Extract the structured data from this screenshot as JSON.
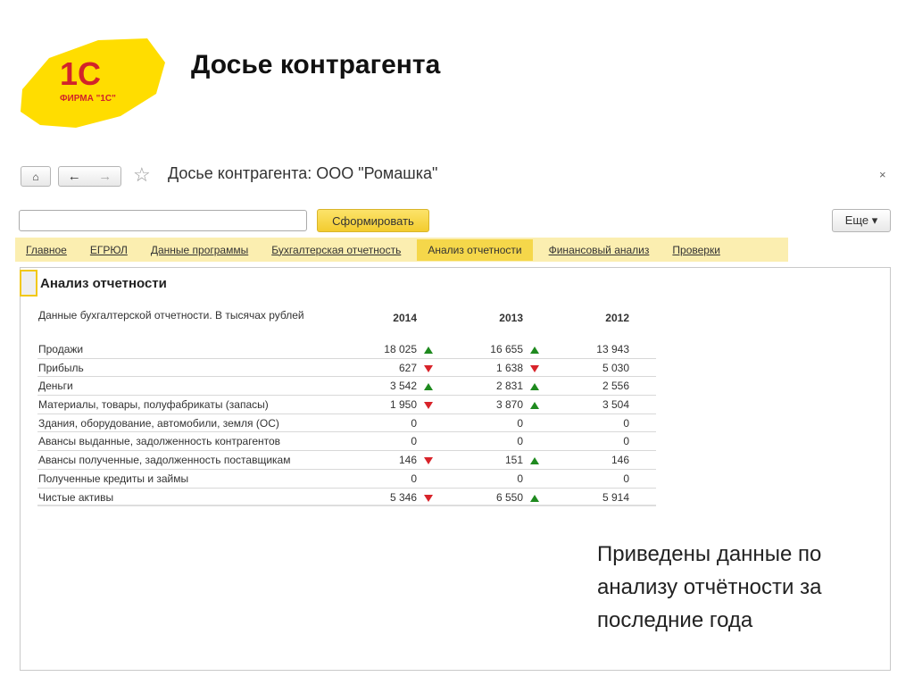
{
  "slide": {
    "title": "Досье контрагента",
    "logo_text": "ФИРМА \"1С\"",
    "logo_mark": "1С",
    "note": "Приведены данные по анализу отчётности за последние года"
  },
  "window": {
    "title": "Досье контрагента: ООО \"Ромашка\"",
    "close": "×"
  },
  "toolbar": {
    "search_value": "",
    "generate_label": "Сформировать",
    "more_label": "Еще ▾"
  },
  "tabs": [
    {
      "label": "Главное"
    },
    {
      "label": "ЕГРЮЛ"
    },
    {
      "label": "Данные программы"
    },
    {
      "label": "Бухгалтерская отчетность"
    },
    {
      "label": "Анализ отчетности",
      "active": true
    },
    {
      "label": "Финансовый анализ"
    },
    {
      "label": "Проверки"
    }
  ],
  "section": {
    "title": "Анализ отчетности"
  },
  "table": {
    "caption": "Данные бухгалтерской отчетности. В тысячах рублей",
    "years": [
      "2014",
      "2013",
      "2012"
    ],
    "rows": [
      {
        "label": "Продажи",
        "values": [
          "18 025",
          "16 655",
          "13 943"
        ],
        "trend": [
          "up",
          "up",
          ""
        ]
      },
      {
        "label": "Прибыль",
        "values": [
          "627",
          "1 638",
          "5 030"
        ],
        "trend": [
          "down",
          "down",
          ""
        ]
      },
      {
        "label": "Деньги",
        "values": [
          "3 542",
          "2 831",
          "2 556"
        ],
        "trend": [
          "up",
          "up",
          ""
        ]
      },
      {
        "label": "Материалы, товары, полуфабрикаты (запасы)",
        "values": [
          "1 950",
          "3 870",
          "3 504"
        ],
        "trend": [
          "down",
          "up",
          ""
        ]
      },
      {
        "label": "Здания, оборудование, автомобили, земля (ОС)",
        "values": [
          "0",
          "0",
          "0"
        ],
        "trend": [
          "",
          "",
          ""
        ]
      },
      {
        "label": "Авансы выданные, задолженность контрагентов",
        "values": [
          "0",
          "0",
          "0"
        ],
        "trend": [
          "",
          "",
          ""
        ]
      },
      {
        "label": "Авансы полученные, задолженность поставщикам",
        "values": [
          "146",
          "151",
          "146"
        ],
        "trend": [
          "down",
          "up",
          ""
        ]
      },
      {
        "label": "Полученные кредиты и займы",
        "values": [
          "0",
          "0",
          "0"
        ],
        "trend": [
          "",
          "",
          ""
        ]
      },
      {
        "label": "Чистые активы",
        "values": [
          "5 346",
          "6 550",
          "5 914"
        ],
        "trend": [
          "down",
          "up",
          ""
        ]
      }
    ]
  },
  "colors": {
    "accent": "#f3cc2f",
    "tabs_bg": "#fbeeb0",
    "up": "#1f8a1f",
    "down": "#d8232a",
    "logo_red": "#d2232a",
    "logo_yellow": "#ffdd00"
  }
}
